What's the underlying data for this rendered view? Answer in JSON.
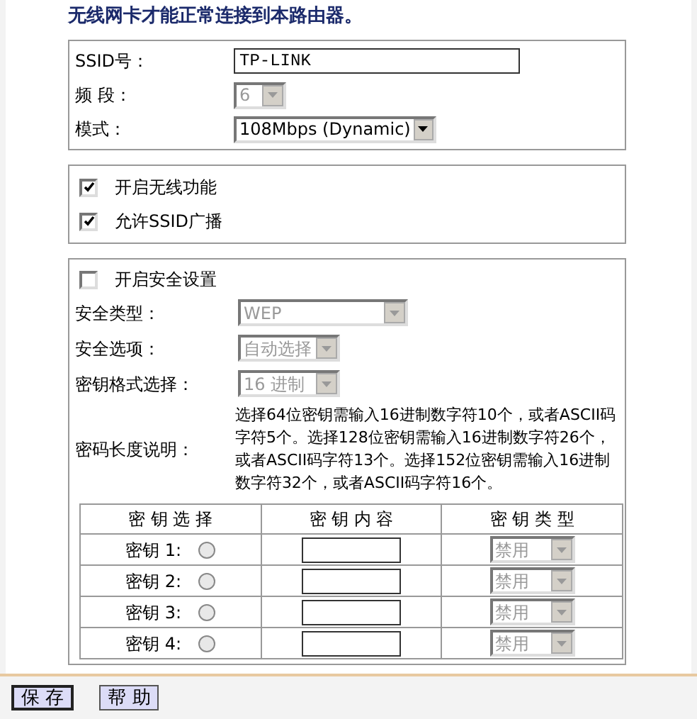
{
  "heading": "无线网卡才能正常连接到本路由器。",
  "basic": [
    {
      "kind": "text",
      "label": "SSID号：",
      "value": "TP-LINK"
    },
    {
      "kind": "select",
      "label": "频 段：",
      "value": "6",
      "disabled": true
    },
    {
      "kind": "select",
      "label": "模式：",
      "value": "108Mbps (Dynamic)",
      "disabled": false
    }
  ],
  "switches": [
    {
      "label": "开启无线功能",
      "checked": true
    },
    {
      "label": "允许SSID广播",
      "checked": true
    }
  ],
  "security": {
    "enable": {
      "label": "开启安全设置",
      "checked": false
    },
    "fields": [
      {
        "label": "安全类型：",
        "value": "WEP",
        "disabled": true
      },
      {
        "label": "安全选项：",
        "value": "自动选择",
        "disabled": true
      },
      {
        "label": "密钥格式选择：",
        "value": "16 进制",
        "disabled": true
      }
    ],
    "note_label": "密码长度说明：",
    "note": "选择64位密钥需输入16进制数字符10个，或者ASCII码字符5个。选择128位密钥需输入16进制数字符26个，或者ASCII码字符13个。选择152位密钥需输入16进制数字符32个，或者ASCII码字符16个。",
    "table": {
      "columns": [
        "密 钥 选 择",
        "密 钥 内 容",
        "密 钥 类 型"
      ],
      "rows": [
        {
          "label": "密钥 1:",
          "selected": false,
          "type": "禁用",
          "disabled": true
        },
        {
          "label": "密钥 2:",
          "selected": false,
          "type": "禁用",
          "disabled": true
        },
        {
          "label": "密钥 3:",
          "selected": false,
          "type": "禁用",
          "disabled": true
        },
        {
          "label": "密钥 4:",
          "selected": false,
          "type": "禁用",
          "disabled": true
        }
      ]
    }
  },
  "buttons": [
    {
      "label": "保 存",
      "focused": true
    },
    {
      "label": "帮 助",
      "focused": false
    }
  ]
}
